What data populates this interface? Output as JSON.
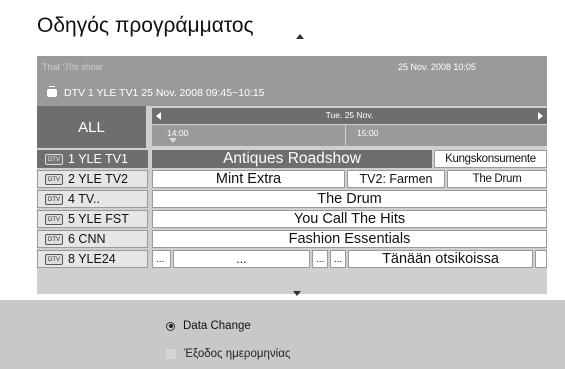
{
  "title": "Οδηγός προγράμματος",
  "info": {
    "program": "That '70s show",
    "date": "25 Nov. 2008 10:05",
    "channel_line": "DTV  1 YLE TV1 25 Nov. 2008 09:45~10:15"
  },
  "grid": {
    "all_label": "ALL",
    "date_label": "Tue. 25 Nov.",
    "times": [
      "14:00",
      "15:00"
    ],
    "channel_badge": "DTV",
    "channels": [
      {
        "label": "1  YLE TV1",
        "selected": true
      },
      {
        "label": "2  YLE TV2"
      },
      {
        "label": "4  TV.."
      },
      {
        "label": "5  YLE FST"
      },
      {
        "label": "6  CNN"
      },
      {
        "label": "8  YLE24"
      }
    ],
    "rows": [
      [
        "Antiques Roadshow",
        "Kungskonsumente"
      ],
      [
        "Mint Extra",
        "TV2: Farmen",
        "The Drum"
      ],
      [
        "The Drum"
      ],
      [
        "You Call The Hits"
      ],
      [
        "Fashion Essentials"
      ],
      [
        "...",
        "...",
        "...",
        "...",
        "Tänään otsikoissa",
        ""
      ]
    ]
  },
  "footer": {
    "option1": "Data Change",
    "option2": "Έξοδος ημερομηνίας"
  },
  "colors": {
    "selected": "#6e6e6e",
    "header_gray": "#9a9a9a",
    "grid_bg": "#cfcfcf",
    "footer_bg": "#c8c8c8"
  }
}
